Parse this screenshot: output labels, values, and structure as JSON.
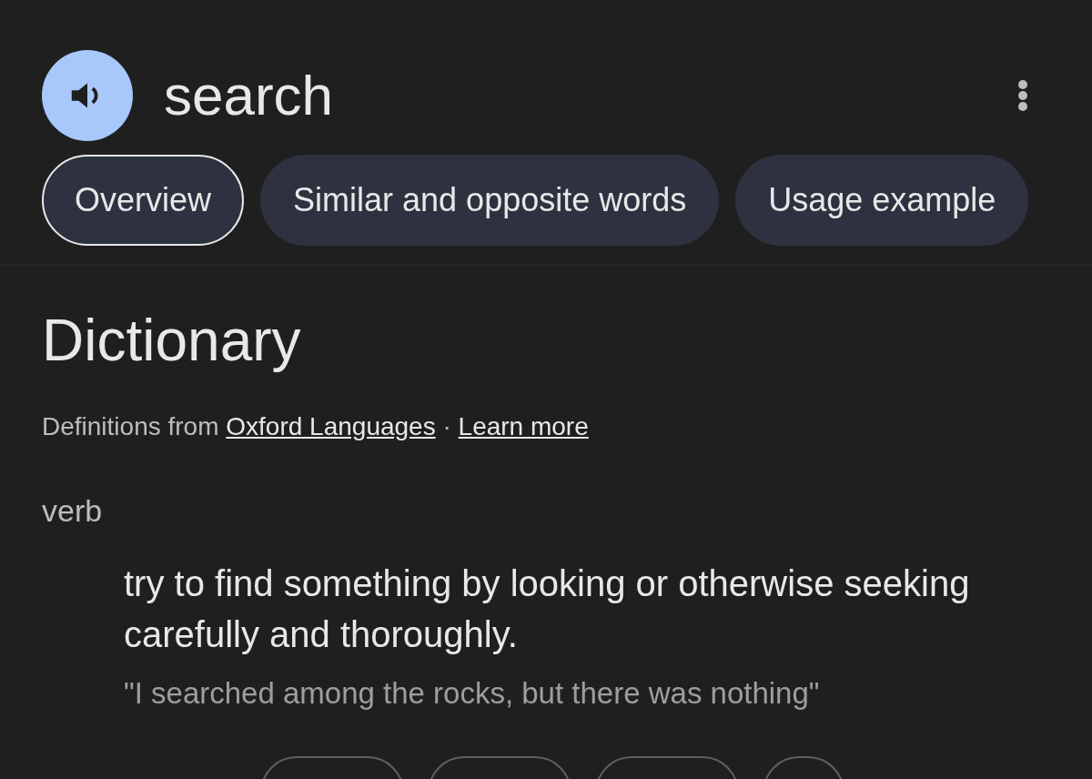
{
  "header": {
    "word": "search"
  },
  "tabs": [
    {
      "label": "Overview",
      "selected": true
    },
    {
      "label": "Similar and opposite words",
      "selected": false
    },
    {
      "label": "Usage example",
      "selected": false
    }
  ],
  "dictionary": {
    "title": "Dictionary",
    "source_prefix": "Definitions from",
    "source_link": "Oxford Languages",
    "separator": "·",
    "learn_more": "Learn more"
  },
  "entry": {
    "part_of_speech": "verb",
    "definition": "try to find something by looking or otherwise seeking carefully and thoroughly.",
    "example": "\"I searched among the rocks, but there was nothing\""
  },
  "similar_chips": [
    {
      "kind": "chip"
    },
    {
      "kind": "chip"
    },
    {
      "kind": "chip"
    },
    {
      "kind": "round"
    }
  ]
}
